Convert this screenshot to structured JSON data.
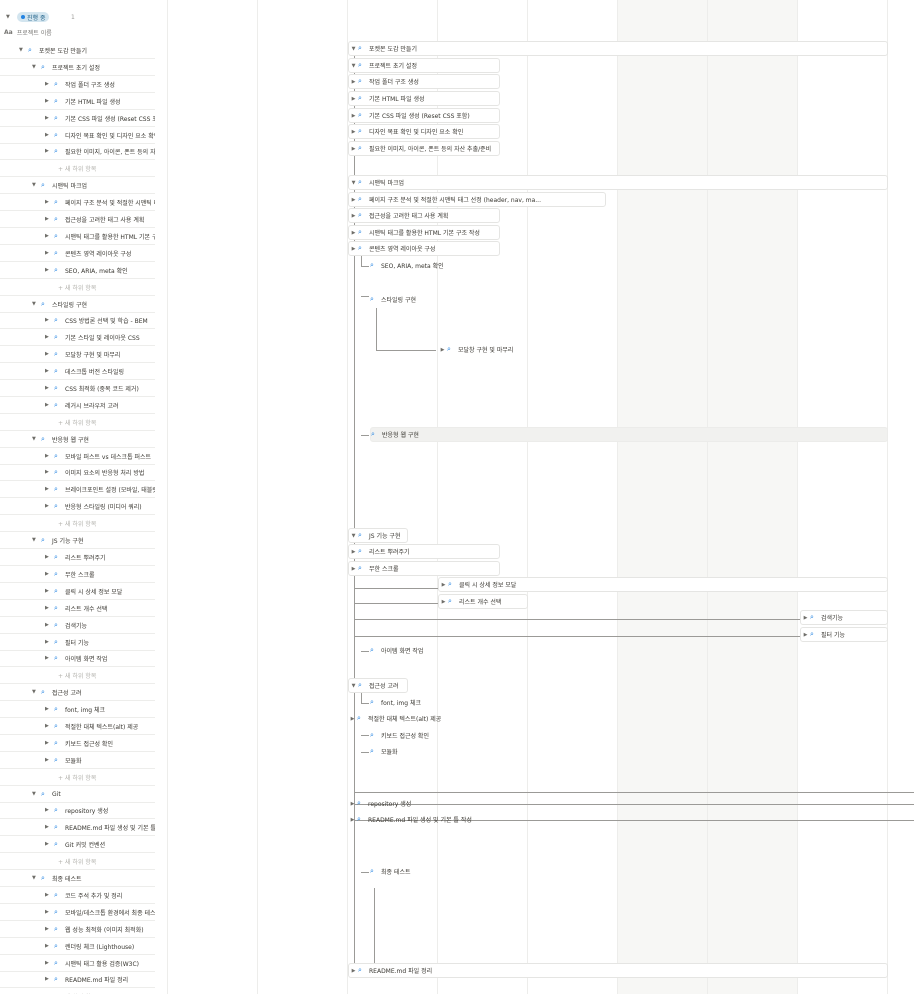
{
  "group": {
    "status": "진행 중",
    "count": "1",
    "property_header_icon": "Aa",
    "property_header": "프로젝트 이름"
  },
  "tree": [
    {
      "level": 0,
      "label": "포켓몬 도감 만들기",
      "open": true
    },
    {
      "level": 1,
      "label": "프로젝트 초기 설정",
      "open": true
    },
    {
      "level": 2,
      "label": "작업 폴더 구조 생성"
    },
    {
      "level": 2,
      "label": "기본 HTML 파일 생성"
    },
    {
      "level": 2,
      "label": "기본 CSS 파일 생성 (Reset CSS 포함)"
    },
    {
      "level": 2,
      "label": "디자인 목표 확인 및 디자인 요소 확인"
    },
    {
      "level": 2,
      "label": "필요한 이미지, 아이콘, 폰트 등의 자산 추출/준비"
    },
    {
      "new": true,
      "label": "+ 새 하위 항목"
    },
    {
      "level": 1,
      "label": "시맨틱 마크업",
      "open": true
    },
    {
      "level": 2,
      "label": "페이지 구조 분석 및 적절한 시맨틱 태그 선정"
    },
    {
      "level": 2,
      "label": "접근성을 고려한 태그 사용 계획"
    },
    {
      "level": 2,
      "label": "시맨틱 태그를 활용한 HTML 기본 구조 작성"
    },
    {
      "level": 2,
      "label": "콘텐츠 영역 레이아웃 구성"
    },
    {
      "level": 2,
      "label": "SEO, ARIA, meta 확인"
    },
    {
      "new": true,
      "label": "+ 새 하위 항목"
    },
    {
      "level": 1,
      "label": "스타일링 구현",
      "open": true
    },
    {
      "level": 2,
      "label": "CSS 방법론 선택 및 학습 - BEM"
    },
    {
      "level": 2,
      "label": "기본 스타일 및 레이아웃 CSS"
    },
    {
      "level": 2,
      "label": "모달창 구현 및 마무리"
    },
    {
      "level": 2,
      "label": "데스크톱 버전 스타일링"
    },
    {
      "level": 2,
      "label": "CSS 최적화 (중복 코드 제거)"
    },
    {
      "level": 2,
      "label": "레거시 브라우저 고려"
    },
    {
      "new": true,
      "label": "+ 새 하위 항목"
    },
    {
      "level": 1,
      "label": "반응형 웹 구현",
      "open": true
    },
    {
      "level": 2,
      "label": "모바일 퍼스트 vs 데스크톱 퍼스트"
    },
    {
      "level": 2,
      "label": "이미지 요소의 반응형 처리 방법"
    },
    {
      "level": 2,
      "label": "브레이크포인트 설정 (모바일, 태블릿)"
    },
    {
      "level": 2,
      "label": "반응형 스타일링 (미디어 쿼리)"
    },
    {
      "new": true,
      "label": "+ 새 하위 항목"
    },
    {
      "level": 1,
      "label": "JS 기능 구현",
      "open": true
    },
    {
      "level": 2,
      "label": "리스트 뿌려주기"
    },
    {
      "level": 2,
      "label": "무한 스크롤"
    },
    {
      "level": 2,
      "label": "클릭 시 상세 정보 모달"
    },
    {
      "level": 2,
      "label": "리스트 개수 선택"
    },
    {
      "level": 2,
      "label": "검색기능"
    },
    {
      "level": 2,
      "label": "필터 기능"
    },
    {
      "level": 2,
      "label": "아이템 화면 작업"
    },
    {
      "new": true,
      "label": "+ 새 하위 항목"
    },
    {
      "level": 1,
      "label": "접근성 고려",
      "open": true
    },
    {
      "level": 2,
      "label": "font, img 체크"
    },
    {
      "level": 2,
      "label": "적절한 대체 텍스트(alt) 제공"
    },
    {
      "level": 2,
      "label": "키보드 접근성 확인"
    },
    {
      "level": 2,
      "label": "모듈화"
    },
    {
      "new": true,
      "label": "+ 새 하위 항목"
    },
    {
      "level": 1,
      "label": "Git",
      "open": true
    },
    {
      "level": 2,
      "label": "repository 생성"
    },
    {
      "level": 2,
      "label": "README.md 파일 생성 및 기본 틀 작성"
    },
    {
      "level": 2,
      "label": "Git 커밋 컨벤션"
    },
    {
      "new": true,
      "label": "+ 새 하위 항목"
    },
    {
      "level": 1,
      "label": "최종 테스트",
      "open": true
    },
    {
      "level": 2,
      "label": "코드 주석 추가 및 정리"
    },
    {
      "level": 2,
      "label": "모바일/데스크톱 환경에서 최종 테스트"
    },
    {
      "level": 2,
      "label": "웹 성능 최적화 (이미지 최적화)"
    },
    {
      "level": 2,
      "label": "렌더링 체크 (Lighthouse)"
    },
    {
      "level": 2,
      "label": "시맨틱 태그 활용 검증(W3C)"
    },
    {
      "level": 2,
      "label": "README.md 파일 정리"
    },
    {
      "new": true,
      "label": "+ 새 하위 항목"
    }
  ],
  "timeline_items": [
    {
      "label": "포켓몬 도감 만들기",
      "toggle": true
    },
    {
      "label": "프로젝트 초기 설정",
      "toggle": true
    },
    {
      "label": "작업 폴더 구조 생성",
      "toggle": true
    },
    {
      "label": "기본 HTML 파일 생성",
      "toggle": true
    },
    {
      "label": "기본 CSS 파일 생성 (Reset CSS 포함)",
      "toggle": true
    },
    {
      "label": "디자인 목표 확인 및 디자인 요소 확인",
      "toggle": true
    },
    {
      "label": "필요한 이미지, 아이콘, 폰트 등의 자산 추출/준비",
      "toggle": true
    },
    {
      "label": "시맨틱 마크업",
      "toggle": true
    },
    {
      "label": "페이지 구조 분석 및 적절한 시맨틱 태그 선정 (header, nav, ma...",
      "toggle": true
    },
    {
      "label": "접근성을 고려한 태그 사용 계획",
      "toggle": true
    },
    {
      "label": "시맨틱 태그를 활용한 HTML 기본 구조 작성",
      "toggle": true
    },
    {
      "label": "콘텐츠 영역 레이아웃 구성",
      "toggle": true
    },
    {
      "label": "SEO, ARIA, meta 확인"
    },
    {
      "label": "스타일링 구현"
    },
    {
      "label": "모달창 구현 및 마무리",
      "toggle": true
    },
    {
      "label": "반응형 웹 구현"
    },
    {
      "label": "JS 기능 구현",
      "toggle": true
    },
    {
      "label": "리스트 뿌려주기",
      "toggle": true
    },
    {
      "label": "무한 스크롤",
      "toggle": true
    },
    {
      "label": "클릭 시 상세 정보 모달",
      "toggle": true
    },
    {
      "label": "리스트 개수 선택",
      "toggle": true
    },
    {
      "label": "검색기능",
      "toggle": true
    },
    {
      "label": "필터 기능",
      "toggle": true
    },
    {
      "label": "아이템 화면 작업"
    },
    {
      "label": "접근성 고려",
      "toggle": true
    },
    {
      "label": "font, img 체크"
    },
    {
      "label": "적절한 대체 텍스트(alt) 제공",
      "toggle": true
    },
    {
      "label": "키보드 접근성 확인"
    },
    {
      "label": "모듈화"
    },
    {
      "label": "repository 생성",
      "toggle": true
    },
    {
      "label": "README.md 파일 생성 및 기본 틀 작성",
      "toggle": true
    },
    {
      "label": "최종 테스트"
    },
    {
      "label": "README.md 파일 정리",
      "toggle": true
    }
  ],
  "icons": {
    "item_icon": "magnifier-icon",
    "accent": "#2383e2"
  }
}
